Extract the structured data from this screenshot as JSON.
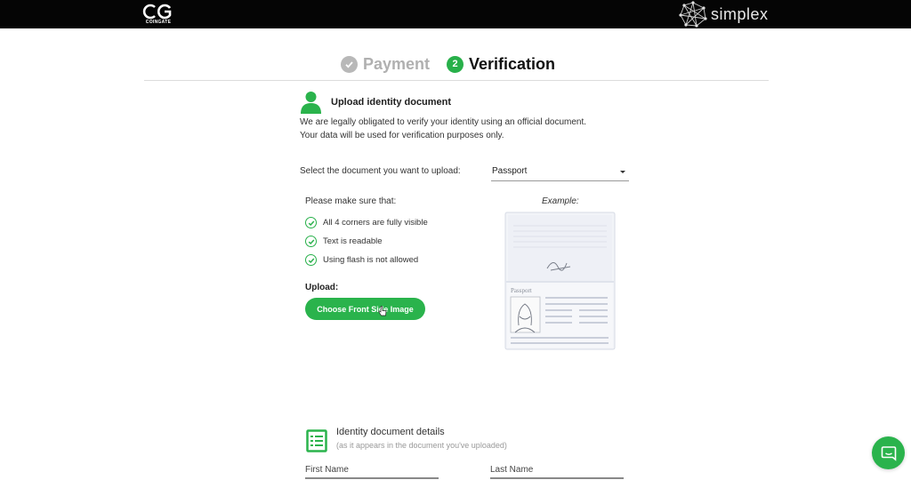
{
  "header": {
    "brand_left": "COINGATE",
    "brand_right": "simplex"
  },
  "steps": [
    {
      "label": "Payment",
      "state": "done"
    },
    {
      "number": "2",
      "label": "Verification",
      "state": "active"
    }
  ],
  "upload_section": {
    "title": "Upload identity document",
    "intro_line1": "We are legally obligated to verify your identity using an official document.",
    "intro_line2": "Your data will be used for verification purposes only.",
    "select_label": "Select the document you want to upload:",
    "document_type": "Passport",
    "make_sure_label": "Please make sure that:",
    "requirements": [
      "All 4 corners are fully visible",
      "Text is readable",
      "Using flash is not allowed"
    ],
    "upload_label": "Upload:",
    "upload_button": "Choose Front Side Image",
    "example_label": "Example:",
    "example_passport_word": "Passport"
  },
  "details_section": {
    "title": "Identity document details",
    "subtitle": "(as it appears in the document you've uploaded)",
    "first_name_label": "First Name",
    "last_name_label": "Last Name"
  },
  "colors": {
    "brand_green": "#2ab34c",
    "topbar": "#050505",
    "step_inactive": "#b8b8b8"
  },
  "icons": {
    "chat": "chat-icon",
    "user": "user-icon",
    "check": "check-circle-icon",
    "document": "document-list-icon"
  }
}
